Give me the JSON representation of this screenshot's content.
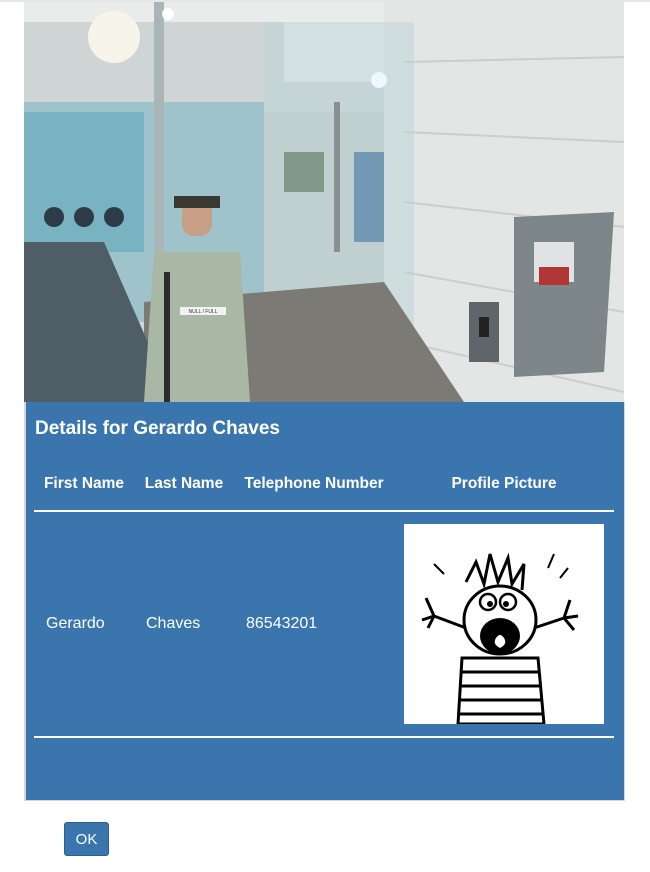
{
  "camera_image": {
    "icon": "security-camera-photo",
    "sign_text": "NULL / FULL"
  },
  "details": {
    "title": "Details for Gerardo Chaves",
    "columns": [
      "First Name",
      "Last Name",
      "Telephone Number",
      "Profile Picture"
    ],
    "row": {
      "first_name": "Gerardo",
      "last_name": "Chaves",
      "telephone": "86543201",
      "profile_icon": "screaming-cartoon-icon"
    }
  },
  "ok_label": "OK",
  "colors": {
    "panel": "#3a76ad",
    "button": "#3a76ad",
    "text": "#ffffff"
  }
}
